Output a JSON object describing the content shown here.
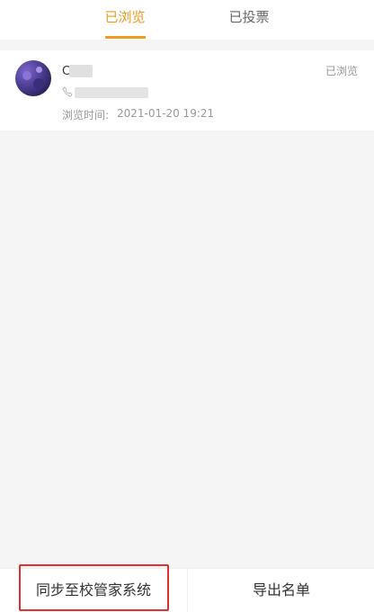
{
  "tabs": [
    {
      "label": "已浏览",
      "active": true
    },
    {
      "label": "已投票",
      "active": false
    }
  ],
  "record": {
    "name_initial": "C",
    "status": "已浏览",
    "browse_label": "浏览时间:",
    "browse_time": "2021-01-20 19:21"
  },
  "bottom": {
    "sync_label": "同步至校管家系统",
    "export_label": "导出名单"
  },
  "colors": {
    "accent": "#f0981f",
    "highlight": "#e03030"
  }
}
